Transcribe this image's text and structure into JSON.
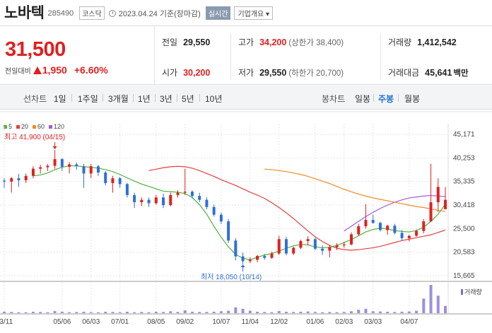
{
  "header": {
    "stock_name": "노바텍",
    "stock_code": "285490",
    "market": "코스닥",
    "date": "2023.04.24 기준(장마감)",
    "realtime_button": "실시간",
    "company_button": "기업개요 ▾"
  },
  "price": {
    "current": "31,500",
    "change_label": "전일대비",
    "change_value": "1,950",
    "change_percent": "+6.60%",
    "prev_close_label": "전일",
    "prev_close": "29,550",
    "high_label": "고가",
    "high": "34,200",
    "upper_limit": "(상한가 38,400)",
    "volume_label": "거래량",
    "volume": "1,412,542",
    "open_label": "시가",
    "open": "30,200",
    "low_label": "저가",
    "low": "29,550",
    "lower_limit": "(하한가 20,700)",
    "amount_label": "거래대금",
    "amount": "45,641",
    "amount_unit": "백만"
  },
  "toolbar": {
    "line_label": "선차트",
    "line_options": [
      "1일",
      "1주일",
      "3개월",
      "1년",
      "3년",
      "5년",
      "10년"
    ],
    "candle_label": "봉차트",
    "candle_options": [
      "일봉",
      "주봉",
      "월봉"
    ],
    "active_candle": "주봉"
  },
  "colors": {
    "up": "#e0201f",
    "down": "#2f6fd6",
    "ma5": "#4db33d",
    "ma20": "#e3413f",
    "ma60": "#f08a24",
    "ma120": "#a259d9",
    "volume": "#7a6bd0"
  },
  "chart_data": {
    "type": "candlestick",
    "interval": "weekly",
    "legend": [
      {
        "name": "5",
        "color": "#4db33d"
      },
      {
        "name": "20",
        "color": "#e3413f"
      },
      {
        "name": "60",
        "color": "#f08a24"
      },
      {
        "name": "120",
        "color": "#a259d9"
      }
    ],
    "y_ticks": [
      "45,171",
      "40,253",
      "35,335",
      "30,418",
      "25,500",
      "20,583",
      "15,665"
    ],
    "ylim": [
      15665,
      45171
    ],
    "x_ticks": [
      "03/11",
      "05/06",
      "06/03",
      "07/01",
      "08/05",
      "09/02",
      "10/07",
      "11/04",
      "12/02",
      "01/06",
      "02/03",
      "03/03",
      "04/07"
    ],
    "annotations": {
      "high": "최고 41,900 (04/15)",
      "low": "최저 18,050 (10/14)"
    },
    "volume_label": "거래량",
    "candles": [
      [
        35500,
        36000,
        34000,
        35300
      ],
      [
        35300,
        36300,
        33000,
        36000
      ],
      [
        36000,
        36900,
        34200,
        35600
      ],
      [
        35600,
        37000,
        35000,
        36500
      ],
      [
        36500,
        38500,
        36000,
        38000
      ],
      [
        38000,
        38800,
        37000,
        38300
      ],
      [
        38300,
        39000,
        37500,
        38600
      ],
      [
        38600,
        41900,
        38000,
        40000
      ],
      [
        40000,
        40200,
        37500,
        38400
      ],
      [
        38400,
        39400,
        37000,
        38900
      ],
      [
        38900,
        39300,
        37800,
        38500
      ],
      [
        38500,
        39000,
        34000,
        37000
      ],
      [
        37000,
        39000,
        36000,
        38500
      ],
      [
        38500,
        38800,
        36500,
        37200
      ],
      [
        37200,
        37500,
        34500,
        35000
      ],
      [
        35000,
        36500,
        33000,
        36000
      ],
      [
        36000,
        36300,
        34000,
        34800
      ],
      [
        34800,
        35000,
        32000,
        32500
      ],
      [
        32500,
        33000,
        29800,
        31000
      ],
      [
        31000,
        32000,
        30200,
        31500
      ],
      [
        31500,
        32000,
        30000,
        30800
      ],
      [
        30800,
        32500,
        30500,
        32000
      ],
      [
        32000,
        32800,
        29800,
        30400
      ],
      [
        30400,
        33000,
        30100,
        32500
      ],
      [
        32500,
        33500,
        32000,
        33000
      ],
      [
        33000,
        38000,
        32500,
        33200
      ],
      [
        33200,
        33500,
        31800,
        32300
      ],
      [
        32300,
        33000,
        31000,
        31500
      ],
      [
        31500,
        32000,
        29500,
        30000
      ],
      [
        30000,
        30500,
        28000,
        28400
      ],
      [
        28400,
        28800,
        26500,
        27000
      ],
      [
        27000,
        27500,
        22500,
        23000
      ],
      [
        23000,
        23500,
        18900,
        19700
      ],
      [
        19700,
        20500,
        18050,
        18700
      ],
      [
        18700,
        19500,
        18300,
        19000
      ],
      [
        19000,
        20000,
        18500,
        19800
      ],
      [
        19800,
        20200,
        19000,
        19400
      ],
      [
        19400,
        20700,
        19200,
        20300
      ],
      [
        20300,
        24000,
        20000,
        23300
      ],
      [
        23300,
        23800,
        19900,
        20300
      ],
      [
        20300,
        21700,
        20000,
        21500
      ],
      [
        21500,
        23200,
        21200,
        22900
      ],
      [
        22900,
        23900,
        22000,
        23300
      ],
      [
        23300,
        23600,
        21000,
        21300
      ],
      [
        21300,
        22000,
        20000,
        20900
      ],
      [
        20900,
        22000,
        19500,
        21600
      ],
      [
        21600,
        22500,
        21000,
        22000
      ],
      [
        22000,
        22700,
        21500,
        22200
      ],
      [
        22200,
        24700,
        22000,
        24300
      ],
      [
        24300,
        26500,
        24000,
        26000
      ],
      [
        26000,
        30600,
        25500,
        27300
      ],
      [
        27300,
        28400,
        26500,
        26700
      ],
      [
        26700,
        26900,
        24900,
        25200
      ],
      [
        25200,
        26300,
        24200,
        26100
      ],
      [
        26100,
        26500,
        24300,
        24600
      ],
      [
        24600,
        25200,
        23000,
        23500
      ],
      [
        23500,
        24200,
        22800,
        24000
      ],
      [
        24000,
        25300,
        23800,
        25000
      ],
      [
        25000,
        27500,
        24500,
        27000
      ],
      [
        27000,
        39000,
        26900,
        31000
      ],
      [
        31000,
        36000,
        29000,
        34200
      ],
      [
        29550,
        34200,
        29550,
        31500
      ]
    ],
    "ma5": [
      36500,
      36700,
      37100,
      37800,
      38300,
      38600,
      38600,
      38400,
      38300,
      38100,
      37800,
      37400,
      36800,
      36100,
      35400,
      34800,
      34300,
      33800,
      33300,
      33200,
      33100,
      32800,
      32000,
      30500,
      28500,
      26000,
      23700,
      21700,
      20100,
      19300,
      19000,
      19500,
      20000,
      20300,
      20800,
      21400,
      21900,
      22200,
      22100,
      21700,
      21500,
      21600,
      22000,
      22600,
      23200,
      24000,
      24800,
      25300,
      25600,
      25400,
      25100,
      24900,
      24800,
      25100,
      25800,
      27000,
      28500,
      30600
    ],
    "ma20": [
      37600,
      37900,
      38200,
      38400,
      38500,
      38400,
      38100,
      37600,
      37000,
      36400,
      35700,
      35100,
      34500,
      33800,
      33100,
      32500,
      31800,
      30900,
      29900,
      28800,
      27600,
      26300,
      25000,
      23800,
      22800,
      22000,
      21400,
      21100,
      21000,
      21100,
      21300,
      21500,
      21800,
      22200,
      22600,
      23000,
      23300,
      23600,
      23900,
      24200,
      24700,
      25200
    ],
    "ma60": [
      37900,
      37800,
      37600,
      37400,
      37100,
      36800,
      36400,
      35900,
      35400,
      34900,
      34300,
      33700,
      33200,
      32700,
      32300,
      31900,
      31600,
      31300,
      31000,
      30700,
      30400,
      30100,
      29900,
      29600,
      29300,
      29100
    ],
    "ma120": [
      25000,
      26000,
      27000,
      28000,
      28900,
      29700,
      30400,
      31000,
      31500,
      31900,
      32100,
      32300,
      32400,
      32300,
      32200
    ],
    "volumes": [
      300,
      250,
      200,
      180,
      300,
      250,
      200,
      450,
      300,
      200,
      250,
      300,
      200,
      180,
      300,
      250,
      200,
      300,
      200,
      250,
      200,
      300,
      250,
      400,
      250,
      600,
      300,
      250,
      250,
      300,
      400,
      500,
      1200,
      900,
      500,
      300,
      250,
      200,
      450,
      300,
      250,
      300,
      350,
      250,
      200,
      250,
      200,
      250,
      400,
      700,
      900,
      400,
      350,
      300,
      250,
      300,
      350,
      500,
      3000,
      5800,
      3600,
      1500
    ]
  }
}
